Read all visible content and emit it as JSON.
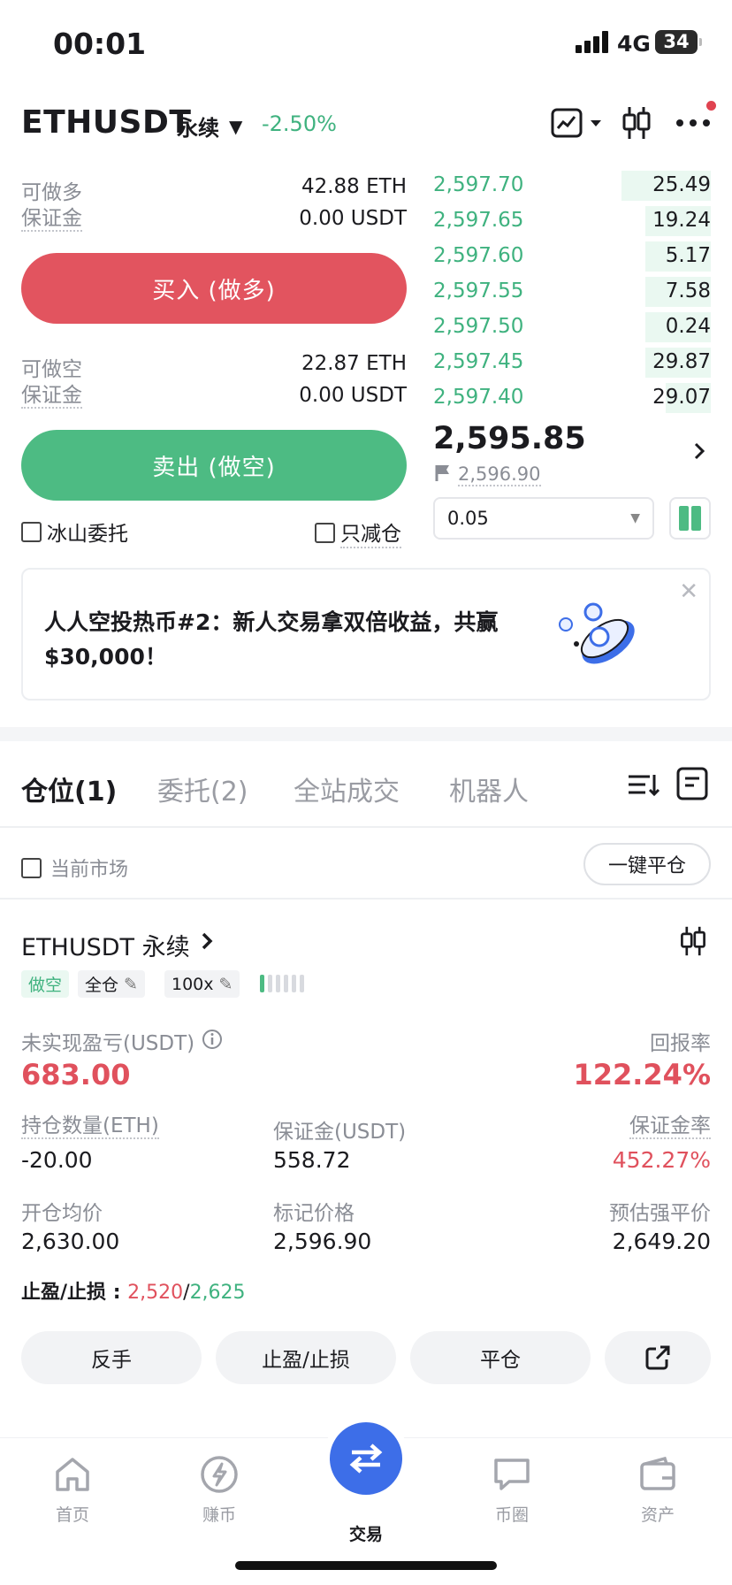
{
  "status_bar": {
    "time": "00:01",
    "network": "4G",
    "battery": "34"
  },
  "header": {
    "symbol": "ETHUSDT",
    "contract": "永续",
    "change": "-2.50%"
  },
  "order_panel": {
    "long_available_label": "可做多",
    "long_available_value": "42.88 ETH",
    "long_margin_label": "保证金",
    "long_margin_value": "0.00 USDT",
    "buy_button": "买入 (做多)",
    "short_available_label": "可做空",
    "short_available_value": "22.87 ETH",
    "short_margin_label": "保证金",
    "short_margin_value": "0.00 USDT",
    "sell_button": "卖出 (做空)",
    "iceberg_label": "冰山委托",
    "reduce_only_label": "只减仓"
  },
  "order_book": {
    "rows": [
      {
        "price": "2,597.70",
        "qty": "25.49",
        "depth": 0.3
      },
      {
        "price": "2,597.65",
        "qty": "19.24",
        "depth": 0.22
      },
      {
        "price": "2,597.60",
        "qty": "5.17",
        "depth": 0.22
      },
      {
        "price": "2,597.55",
        "qty": "7.58",
        "depth": 0.22
      },
      {
        "price": "2,597.50",
        "qty": "0.24",
        "depth": 0.22
      },
      {
        "price": "2,597.45",
        "qty": "29.87",
        "depth": 0.22
      },
      {
        "price": "2,597.40",
        "qty": "29.07",
        "depth": 0.15
      }
    ],
    "last_price": "2,595.85",
    "mark_price": "2,596.90",
    "depth_step": "0.05"
  },
  "banner": {
    "text": "人人空投热币#2：新人交易拿双倍收益，共赢$30,000！"
  },
  "tabs": [
    "仓位(1)",
    "委托(2)",
    "全站成交",
    "机器人"
  ],
  "filter": {
    "current_market_label": "当前市场",
    "close_all_button": "一键平仓"
  },
  "position": {
    "title": "ETHUSDT 永续",
    "side_tag": "做空",
    "margin_mode_tag": "全仓",
    "leverage_tag": "100x",
    "leverage_level": 0.2,
    "unrealized_pnl_label": "未实现盈亏(USDT)",
    "unrealized_pnl": "683.00",
    "roe_label": "回报率",
    "roe": "122.24%",
    "size_label": "持仓数量(ETH)",
    "size": "-20.00",
    "margin_label": "保证金(USDT)",
    "margin": "558.72",
    "margin_ratio_label": "保证金率",
    "margin_ratio": "452.27%",
    "entry_label": "开仓均价",
    "entry": "2,630.00",
    "mark_label": "标记价格",
    "mark": "2,596.90",
    "liq_label": "预估强平价",
    "liq": "2,649.20",
    "tpsl_label": "止盈/止损 : ",
    "tp": "2,520",
    "sl": "2,625",
    "actions": [
      "反手",
      "止盈/止损",
      "平仓"
    ]
  },
  "bottom_nav": [
    "首页",
    "赚币",
    "交易",
    "币圈",
    "资产"
  ],
  "colors": {
    "green": "#3fb27f",
    "red": "#e0515d",
    "accent_blue": "#3d6ee8"
  }
}
